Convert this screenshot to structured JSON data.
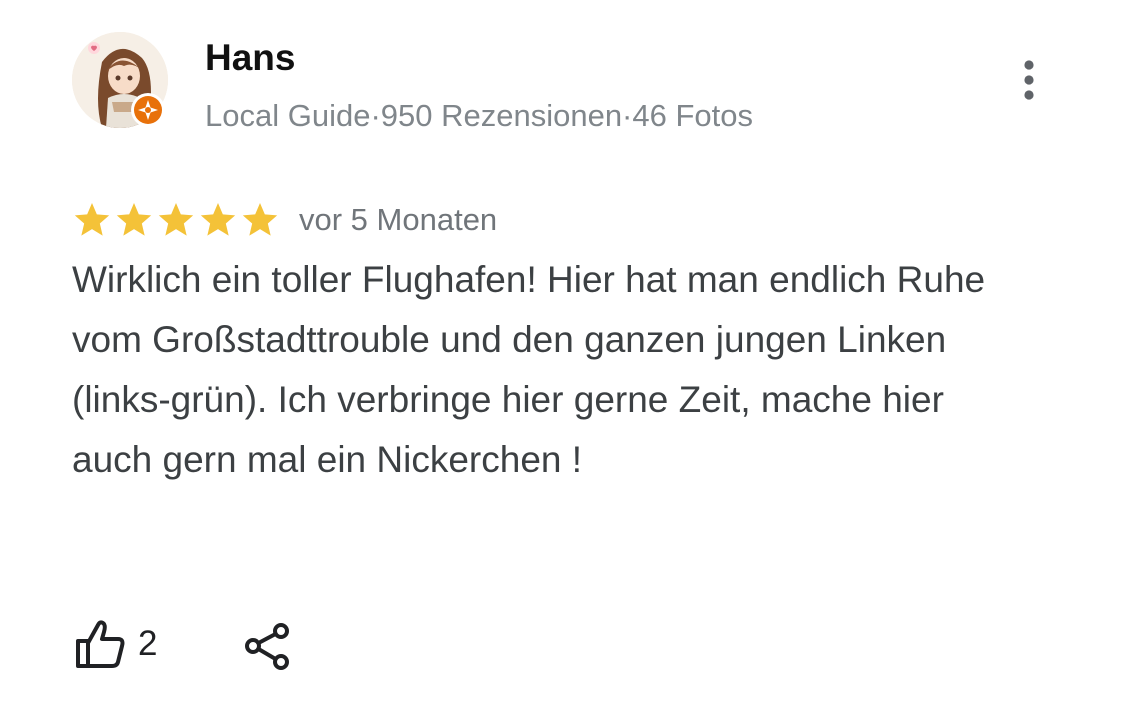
{
  "reviewer": {
    "name": "Hans",
    "meta": "Local Guide·950 Rezensionen·46 Fotos",
    "avatar_icon": "anime-girl-avatar",
    "badge_icon": "local-guide-badge-icon",
    "badge_color": "#e8710a"
  },
  "review": {
    "rating": 5,
    "max_rating": 5,
    "star_color": "#f4c238",
    "date": "vor 5 Monaten",
    "text": "Wirklich ein toller Flughafen! Hier hat man endlich Ruhe vom Großstadttrouble und den ganzen jungen Linken (links-grün). Ich verbringe hier gerne Zeit, mache hier auch gern mal ein Nickerchen !"
  },
  "actions": {
    "like_count": "2",
    "like_icon": "thumbs-up-icon",
    "share_icon": "share-icon",
    "more_icon": "more-vert-icon"
  }
}
